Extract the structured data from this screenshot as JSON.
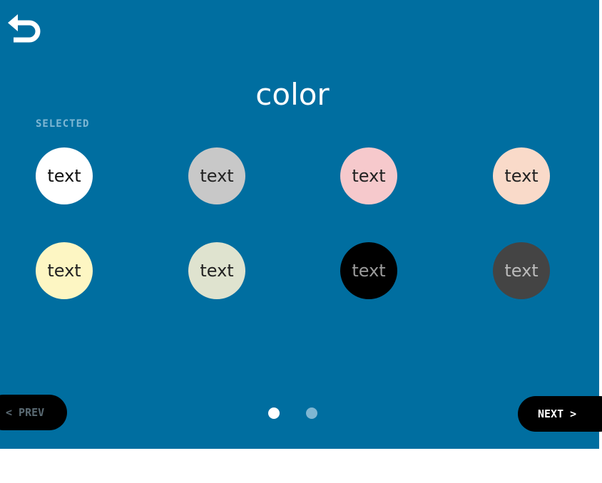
{
  "header": {
    "back_icon": "undo-arrow-icon",
    "title": "color"
  },
  "section": {
    "selected_label": "SELECTED"
  },
  "swatches": [
    {
      "label": "text",
      "bg": "#ffffff",
      "fg": "#111111"
    },
    {
      "label": "text",
      "bg": "#c8c8c8",
      "fg": "#222222"
    },
    {
      "label": "text",
      "bg": "#f6c9cc",
      "fg": "#222222"
    },
    {
      "label": "text",
      "bg": "#f9dac9",
      "fg": "#222222"
    },
    {
      "label": "text",
      "bg": "#fdf6c3",
      "fg": "#222222"
    },
    {
      "label": "text",
      "bg": "#dfe3cf",
      "fg": "#222222"
    },
    {
      "label": "text",
      "bg": "#000000",
      "fg": "#9a9a9a"
    },
    {
      "label": "text",
      "bg": "#444444",
      "fg": "#bbbbbb"
    }
  ],
  "nav": {
    "prev_label": "< PREV",
    "next_label": "NEXT >",
    "pages": [
      {
        "active": true,
        "color": "#ffffff"
      },
      {
        "active": false,
        "color": "#7fb6d2"
      }
    ]
  },
  "colors": {
    "background": "#006ea0",
    "accent_label": "#7fb8d4",
    "button_bg": "#000000"
  }
}
